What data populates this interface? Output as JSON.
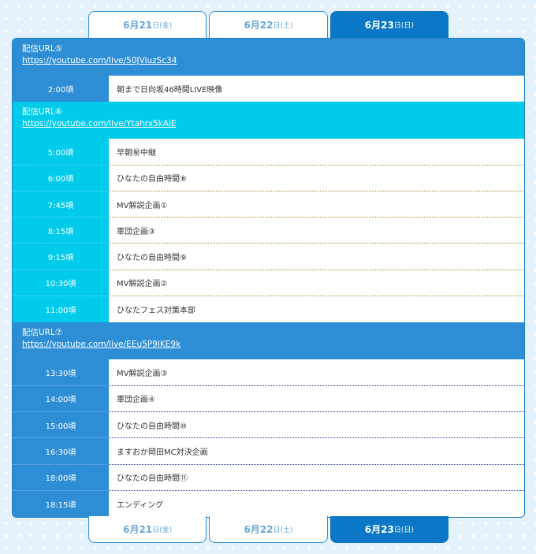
{
  "tabs": [
    {
      "date": "6月21",
      "sub": "日(金)",
      "active": false
    },
    {
      "date": "6月22",
      "sub": "日(土)",
      "active": false
    },
    {
      "date": "6月23",
      "sub": "日(日)",
      "active": true
    }
  ],
  "sections": [
    {
      "label": "配信URL⑤",
      "url": "https://youtube.com/live/50JViuzSc34",
      "rows": [
        {
          "time": "2:00頃",
          "program": "朝まで日向坂46時間LIVE映像"
        }
      ]
    },
    {
      "label": "配信URL⑥",
      "url": "https://youtube.com/live/Ytahrx5kAlE",
      "rows": [
        {
          "time": "5:00頃",
          "program": "早朝㊙中継"
        },
        {
          "time": "6:00頃",
          "program": "ひなたの自由時間⑧"
        },
        {
          "time": "7:45頃",
          "program": "MV解説企画①"
        },
        {
          "time": "8:15頃",
          "program": "軍団企画③"
        },
        {
          "time": "9:15頃",
          "program": "ひなたの自由時間⑨"
        },
        {
          "time": "10:30頃",
          "program": "MV解説企画②"
        },
        {
          "time": "11:00頃",
          "program": "ひなたフェス対策本部"
        }
      ]
    },
    {
      "label": "配信URL⑦",
      "url": "https://youtube.com/live/EEu5P9IKE9k",
      "rows": [
        {
          "time": "13:30頃",
          "program": "MV解説企画③"
        },
        {
          "time": "14:00頃",
          "program": "軍団企画④"
        },
        {
          "time": "15:00頃",
          "program": "ひなたの自由時間⑩"
        },
        {
          "time": "16:30頃",
          "program": "ますおか岡田MC対決企画"
        },
        {
          "time": "18:00頃",
          "program": "ひなたの自由時間⑪"
        },
        {
          "time": "18:15頃",
          "program": "エンディング"
        }
      ]
    }
  ]
}
